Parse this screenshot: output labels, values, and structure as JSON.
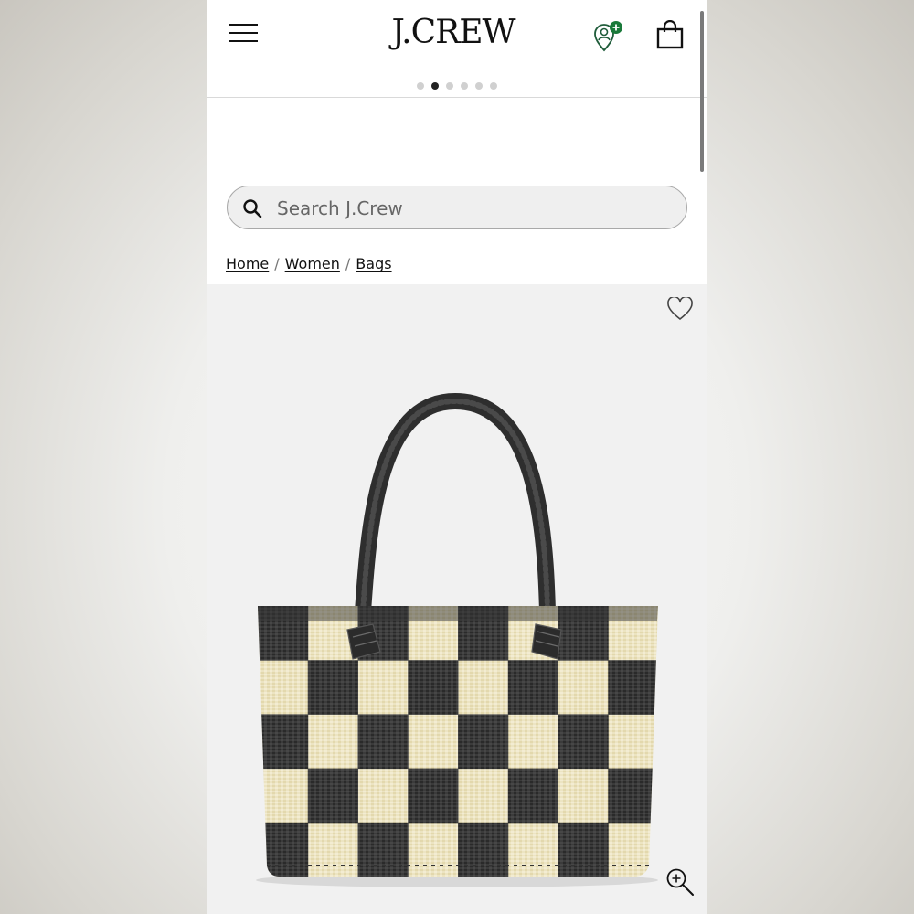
{
  "header": {
    "logo_text": "J.CREW",
    "menu_icon": "hamburger-menu-icon",
    "account_icon": "account-add-icon",
    "bag_icon": "shopping-bag-icon",
    "accent_color": "#1a7a3a"
  },
  "carousel": {
    "dot_count": 6,
    "active_index": 1
  },
  "search": {
    "placeholder": "Search J.Crew",
    "icon": "search-icon"
  },
  "breadcrumb": {
    "items": [
      "Home",
      "Women",
      "Bags"
    ],
    "separator": "/"
  },
  "product": {
    "wishlist_icon": "heart-icon",
    "zoom_icon": "zoom-in-icon",
    "image_icon": "checkered-straw-tote-bag"
  }
}
